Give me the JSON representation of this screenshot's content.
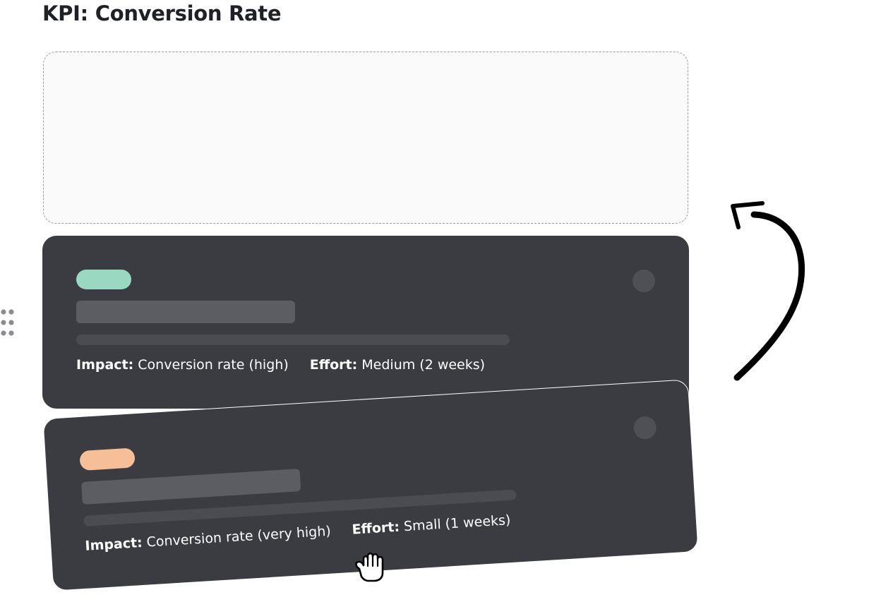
{
  "page": {
    "title": "KPI: Conversion Rate"
  },
  "cards": [
    {
      "tag_color": "#9ad8c2",
      "impact_label": "Impact:",
      "impact_value": "Conversion rate (high)",
      "effort_label": "Effort:",
      "effort_value": "Medium (2 weeks)"
    },
    {
      "tag_color": "#f6bf97",
      "impact_label": "Impact:",
      "impact_value": "Conversion rate (very high)",
      "effort_label": "Effort:",
      "effort_value": "Small (1 weeks)"
    }
  ],
  "icons": {
    "drag_handle": "drag-handle-icon",
    "arrow": "curved-arrow-icon",
    "cursor": "grab-hand-icon"
  },
  "colors": {
    "card_background": "#3a3c41",
    "drop_zone_background": "#fafafa",
    "title_text": "#1f2126"
  }
}
